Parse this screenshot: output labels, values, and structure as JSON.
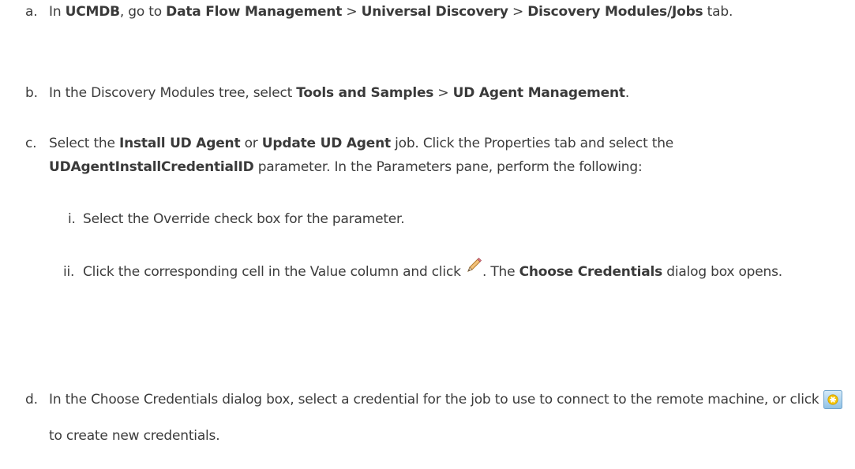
{
  "steps": {
    "a": {
      "marker": "a.",
      "t1": "In ",
      "b1": "UCMDB",
      "t2": ", go to ",
      "b2": "Data Flow Management",
      "t3": " > ",
      "b3": "Universal Discovery",
      "t4": " > ",
      "b4": "Discovery Modules/Jobs",
      "t5": " tab."
    },
    "b": {
      "marker": "b.",
      "t1": "In the Discovery Modules tree, select ",
      "b1": "Tools and Samples",
      "t2": " > ",
      "b2": "UD Agent Management",
      "t3": "."
    },
    "c": {
      "marker": "c.",
      "t1": "Select the ",
      "b1": "Install UD Agent",
      "t2": " or ",
      "b2": "Update UD Agent",
      "t3": " job. Click the Properties tab and select the ",
      "b3": "UDAgentInstallCredentialID",
      "t4": " parameter. In the Parameters pane, perform the following:"
    },
    "c_i": {
      "marker": "i.",
      "t1": "Select the Override check box for the parameter."
    },
    "c_ii": {
      "marker": "ii.",
      "t1": "Click the corresponding cell in the Value column and click ",
      "t2": ". The ",
      "b1": "Choose Credentials",
      "t3": " dialog box opens."
    },
    "d": {
      "marker": "d.",
      "t1": "In the Choose Credentials dialog box, select a credential for the job to use to connect to the remote machine, or click ",
      "t2": " to create new credentials."
    }
  },
  "icons": {
    "edit": "pencil-icon",
    "new_credentials": "new-credentials-icon"
  },
  "colors": {
    "text": "#3c3c3c",
    "icon_button_bg": "#a9d2ee",
    "icon_star": "#f5c400"
  }
}
